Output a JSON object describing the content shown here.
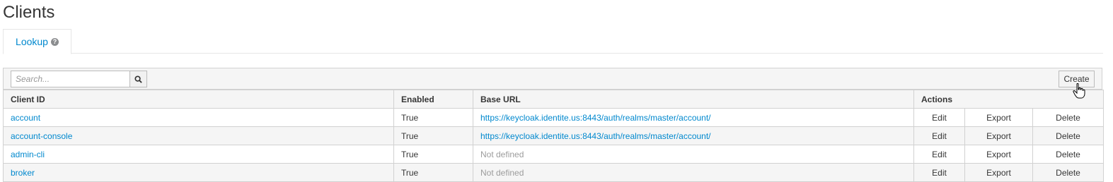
{
  "page": {
    "title": "Clients"
  },
  "tabs": [
    {
      "label": "Lookup"
    }
  ],
  "toolbar": {
    "search_placeholder": "Search...",
    "create_label": "Create"
  },
  "table": {
    "headers": {
      "client_id": "Client ID",
      "enabled": "Enabled",
      "base_url": "Base URL",
      "actions": "Actions"
    },
    "rows": [
      {
        "client_id": "account",
        "enabled": "True",
        "base_url": "https://keycloak.identite.us:8443/auth/realms/master/account/",
        "edit": "Edit",
        "export": "Export",
        "delete": "Delete"
      },
      {
        "client_id": "account-console",
        "enabled": "True",
        "base_url": "https://keycloak.identite.us:8443/auth/realms/master/account/",
        "edit": "Edit",
        "export": "Export",
        "delete": "Delete"
      },
      {
        "client_id": "admin-cli",
        "enabled": "True",
        "base_url": "Not defined",
        "edit": "Edit",
        "export": "Export",
        "delete": "Delete"
      },
      {
        "client_id": "broker",
        "enabled": "True",
        "base_url": "Not defined",
        "edit": "Edit",
        "export": "Export",
        "delete": "Delete"
      }
    ]
  }
}
